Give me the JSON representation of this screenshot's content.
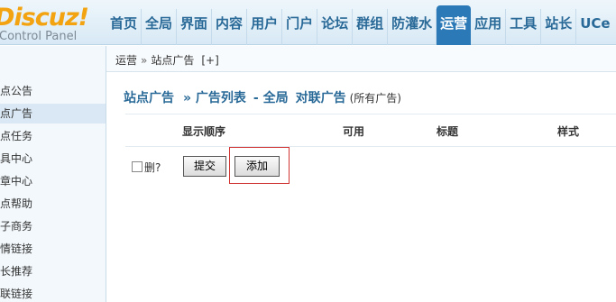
{
  "header": {
    "logo": "Discuz!",
    "logo_sub": "Control Panel",
    "nav": [
      "首页",
      "全局",
      "界面",
      "内容",
      "用户",
      "门户",
      "论坛",
      "群组",
      "防灌水",
      "运营",
      "应用",
      "工具",
      "站长",
      "UCe"
    ],
    "active_nav_index": 9
  },
  "breadcrumb": {
    "section": "运营",
    "separator": "»",
    "page": "站点广告",
    "add": "[+]"
  },
  "sidebar": {
    "items": [
      "点公告",
      "点广告",
      "点任务",
      "具中心",
      "章中心",
      "点帮助",
      "子商务",
      "情链接",
      "长推荐",
      "联链接"
    ],
    "active_index": 1
  },
  "main": {
    "title": "站点广告",
    "title_sub1": "» 广告列表",
    "title_sub2": "- 全局",
    "title_sub3": "对联广告",
    "title_small": "(所有广告)",
    "columns": [
      "显示顺序",
      "可用",
      "标题",
      "样式"
    ],
    "delete_label": "删?",
    "submit_label": "提交",
    "add_label": "添加"
  },
  "colors": {
    "accent": "#2b7ab7",
    "logo": "#f2a30f",
    "highlight_box": "#d13333"
  }
}
